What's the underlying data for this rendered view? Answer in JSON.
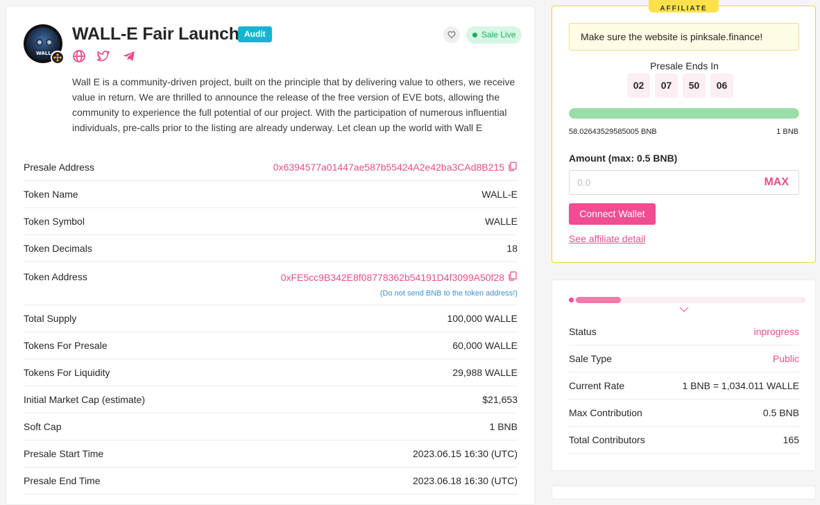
{
  "project": {
    "title": "WALL-E Fair Launch",
    "audit_label": "Audit",
    "status_badge": "Sale Live",
    "logo_text": "WALL-E",
    "description": "Wall E is a community-driven project, built on the principle that by delivering value to others, we receive value in return. We are thrilled to announce the release of the free version of EVE bots, allowing the community to experience the full potential of our project. With the participation of numerous influential individuals, pre-calls prior to the listing are already underway. Let clean up the world with Wall E",
    "socials": [
      "globe-icon",
      "twitter-icon",
      "telegram-icon"
    ]
  },
  "details": {
    "presale_address": {
      "label": "Presale Address",
      "value": "0x6394577a01447ae587b55424A2e42ba3CAd8B215"
    },
    "token_name": {
      "label": "Token Name",
      "value": "WALL-E"
    },
    "token_symbol": {
      "label": "Token Symbol",
      "value": "WALLE"
    },
    "token_decimals": {
      "label": "Token Decimals",
      "value": "18"
    },
    "token_address": {
      "label": "Token Address",
      "value": "0xFE5cc9B342E8f08778362b54191D4f3099A50f28",
      "hint": "(Do not send BNB to the token address!)"
    },
    "total_supply": {
      "label": "Total Supply",
      "value": "100,000 WALLE"
    },
    "tokens_presale": {
      "label": "Tokens For Presale",
      "value": "60,000 WALLE"
    },
    "tokens_liquidity": {
      "label": "Tokens For Liquidity",
      "value": "29,988 WALLE"
    },
    "market_cap": {
      "label": "Initial Market Cap (estimate)",
      "value": "$21,653"
    },
    "soft_cap": {
      "label": "Soft Cap",
      "value": "1 BNB"
    },
    "start_time": {
      "label": "Presale Start Time",
      "value": "2023.06.15 16:30 (UTC)"
    },
    "end_time": {
      "label": "Presale End Time",
      "value": "2023.06.18 16:30 (UTC)"
    }
  },
  "affiliate": {
    "tag": "AFFILIATE",
    "notice": "Make sure the website is pinksale.finance!",
    "ends_label": "Presale Ends In",
    "timer": [
      "02",
      "07",
      "50",
      "06"
    ],
    "progress_fraction": 1.0,
    "raised": "58.02643529585005 BNB",
    "target": "1 BNB",
    "amount_label": "Amount (max: 0.5 BNB)",
    "amount_placeholder": "0.0",
    "max_label": "MAX",
    "connect_label": "Connect Wallet",
    "affiliate_link": "See affiliate detail"
  },
  "status": {
    "stage_fraction": 0.22,
    "rows": [
      {
        "label": "Status",
        "value": "inprogress"
      },
      {
        "label": "Sale Type",
        "value": "Public"
      },
      {
        "label": "Current Rate",
        "value": "1 BNB = 1,034.011 WALLE"
      },
      {
        "label": "Max Contribution",
        "value": "0.5 BNB"
      },
      {
        "label": "Total Contributors",
        "value": "165"
      }
    ]
  },
  "colors": {
    "accent": "#f04d92",
    "link": "#e84e8a",
    "audit": "#17b4d2",
    "live": "#1bae63",
    "progress": "#99ddaa"
  }
}
